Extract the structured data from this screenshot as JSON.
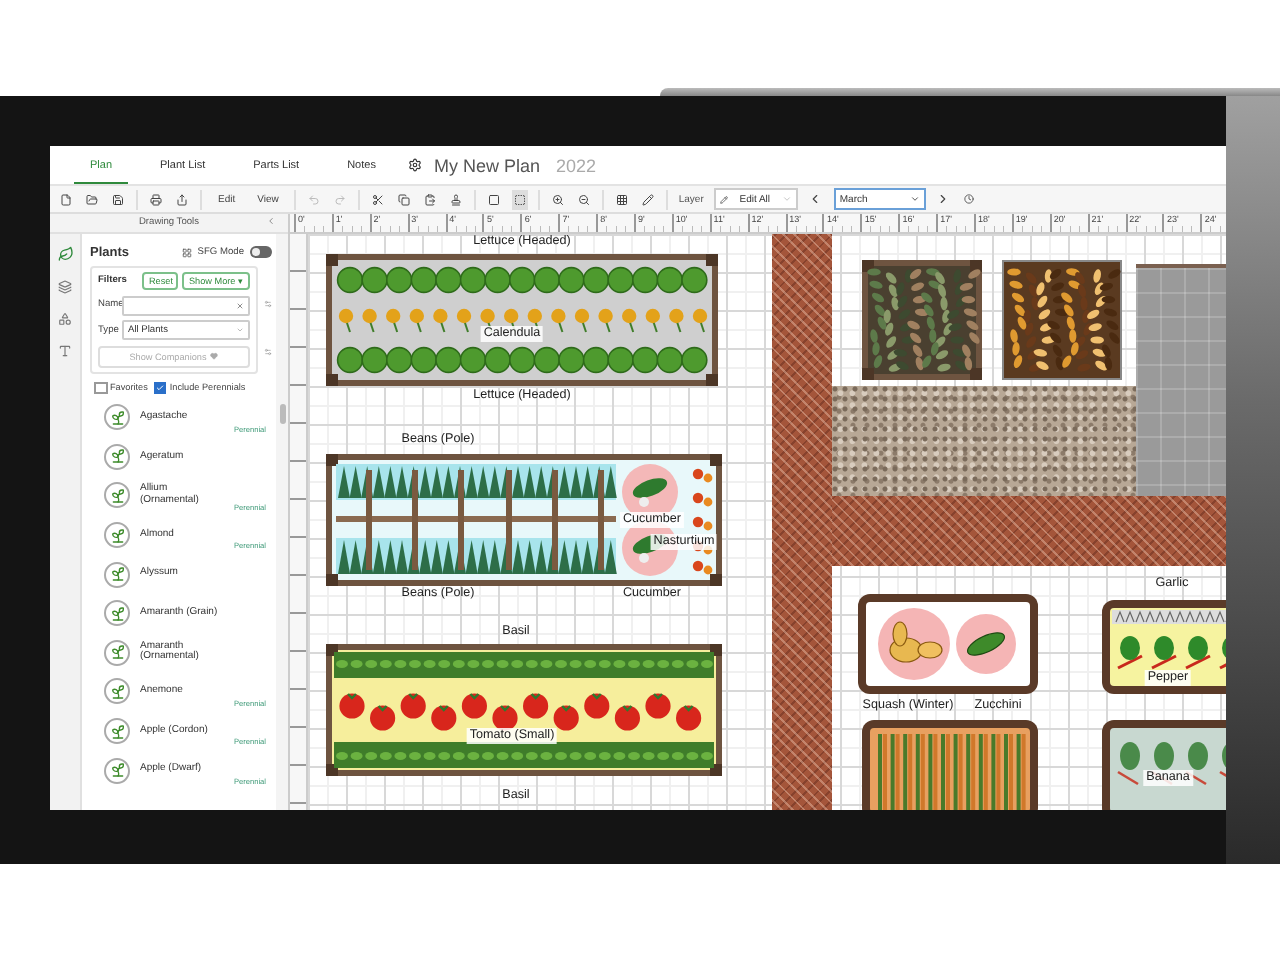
{
  "nav": {
    "tabs": [
      {
        "label": "Plan",
        "selected": true
      },
      {
        "label": "Plant List",
        "selected": false
      },
      {
        "label": "Parts List",
        "selected": false
      },
      {
        "label": "Notes",
        "selected": false
      }
    ],
    "plan_title": "My New Plan",
    "year": "2022"
  },
  "toolbar": {
    "menus": [
      "Edit",
      "View"
    ],
    "layer_label": "Layer",
    "layer_value": "Edit All",
    "month": "March"
  },
  "sidebar": {
    "header": "Drawing Tools",
    "title": "Plants",
    "sfg_mode": {
      "label": "SFG Mode",
      "on": false
    },
    "filters": {
      "title": "Filters",
      "reset": "Reset",
      "show_more": "Show More ▾",
      "name_label": "Name",
      "type_label": "Type",
      "type_value": "All Plants",
      "show_companions": "Show Companions"
    },
    "favorites": {
      "label": "Favorites",
      "checked": false
    },
    "include_perennials": {
      "label": "Include Perennials",
      "checked": true
    },
    "plants": [
      {
        "name": "Agastache",
        "tag": "Perennial"
      },
      {
        "name": "Ageratum"
      },
      {
        "name": "Allium (Ornamental)",
        "tag": "Perennial"
      },
      {
        "name": "Almond",
        "tag": "Perennial"
      },
      {
        "name": "Alyssum"
      },
      {
        "name": "Amaranth (Grain)"
      },
      {
        "name": "Amaranth (Ornamental)"
      },
      {
        "name": "Anemone",
        "tag": "Perennial"
      },
      {
        "name": "Apple (Cordon)",
        "tag": "Perennial"
      },
      {
        "name": "Apple (Dwarf)",
        "tag": "Perennial"
      }
    ]
  },
  "ruler": {
    "labels": [
      "0'",
      "1'",
      "2'",
      "3'",
      "4'",
      "5'",
      "6'",
      "7'",
      "8'",
      "9'",
      "10'",
      "11'",
      "12'",
      "13'",
      "14'",
      "15'",
      "16'",
      "17'",
      "18'",
      "19'",
      "20'",
      "21'",
      "22'",
      "23'",
      "24'"
    ]
  },
  "canvas": {
    "beds": [
      {
        "kind": "rows"
      },
      {
        "kind": "trellis"
      },
      {
        "kind": "tomato"
      },
      {
        "kind": "mulch-dark"
      },
      {
        "kind": "mulch-autumn"
      },
      {
        "kind": "squash"
      },
      {
        "kind": "pepper"
      },
      {
        "kind": "carrot"
      },
      {
        "kind": "banana"
      }
    ],
    "labels": [
      "Lettuce (Headed)",
      "Calendula",
      "Lettuce (Headed)",
      "Beans (Pole)",
      "Cucumber",
      "Nasturtium",
      "Beans (Pole)",
      "Cucumber",
      "Basil",
      "Tomato (Small)",
      "Basil",
      "Garlic",
      "Pepper",
      "Squash (Winter)",
      "Zucchini",
      "Banana"
    ]
  }
}
